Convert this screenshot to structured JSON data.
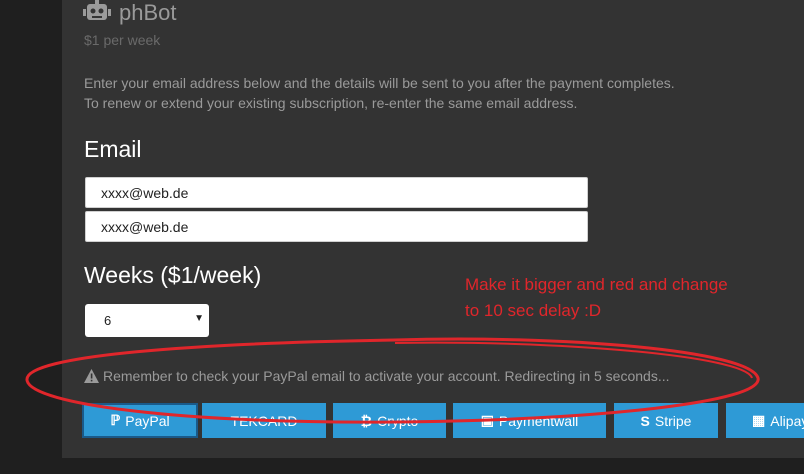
{
  "product": {
    "name": "phBot",
    "price": "$1 per week"
  },
  "intro": {
    "line1": "Enter your email address below and the details will be sent to you after the payment completes.",
    "line2": "To renew or extend your existing subscription, re-enter the same email address."
  },
  "email": {
    "label": "Email",
    "value1": "xxxx@web.de",
    "value2": "xxxx@web.de"
  },
  "weeks": {
    "label": "Weeks ($1/week)",
    "selected": "6"
  },
  "warning": "Remember to check your PayPal email to activate your account. Redirecting in 5 seconds...",
  "annotation": {
    "line1": "Make it bigger and red and change",
    "line2": "to 10 sec delay :D"
  },
  "payment_buttons": [
    {
      "label": "PayPal",
      "icon": "paypal-icon"
    },
    {
      "label": "TEKCARD",
      "icon": ""
    },
    {
      "label": "Crypto",
      "icon": "bitcoin-icon"
    },
    {
      "label": "Paymentwall",
      "icon": "paymentwall-icon"
    },
    {
      "label": "Stripe",
      "icon": "stripe-icon"
    },
    {
      "label": "Alipay",
      "icon": "alipay-icon"
    }
  ],
  "colors": {
    "accent": "#2e9ad6",
    "annotation": "#e0262b",
    "panel": "#333333"
  }
}
